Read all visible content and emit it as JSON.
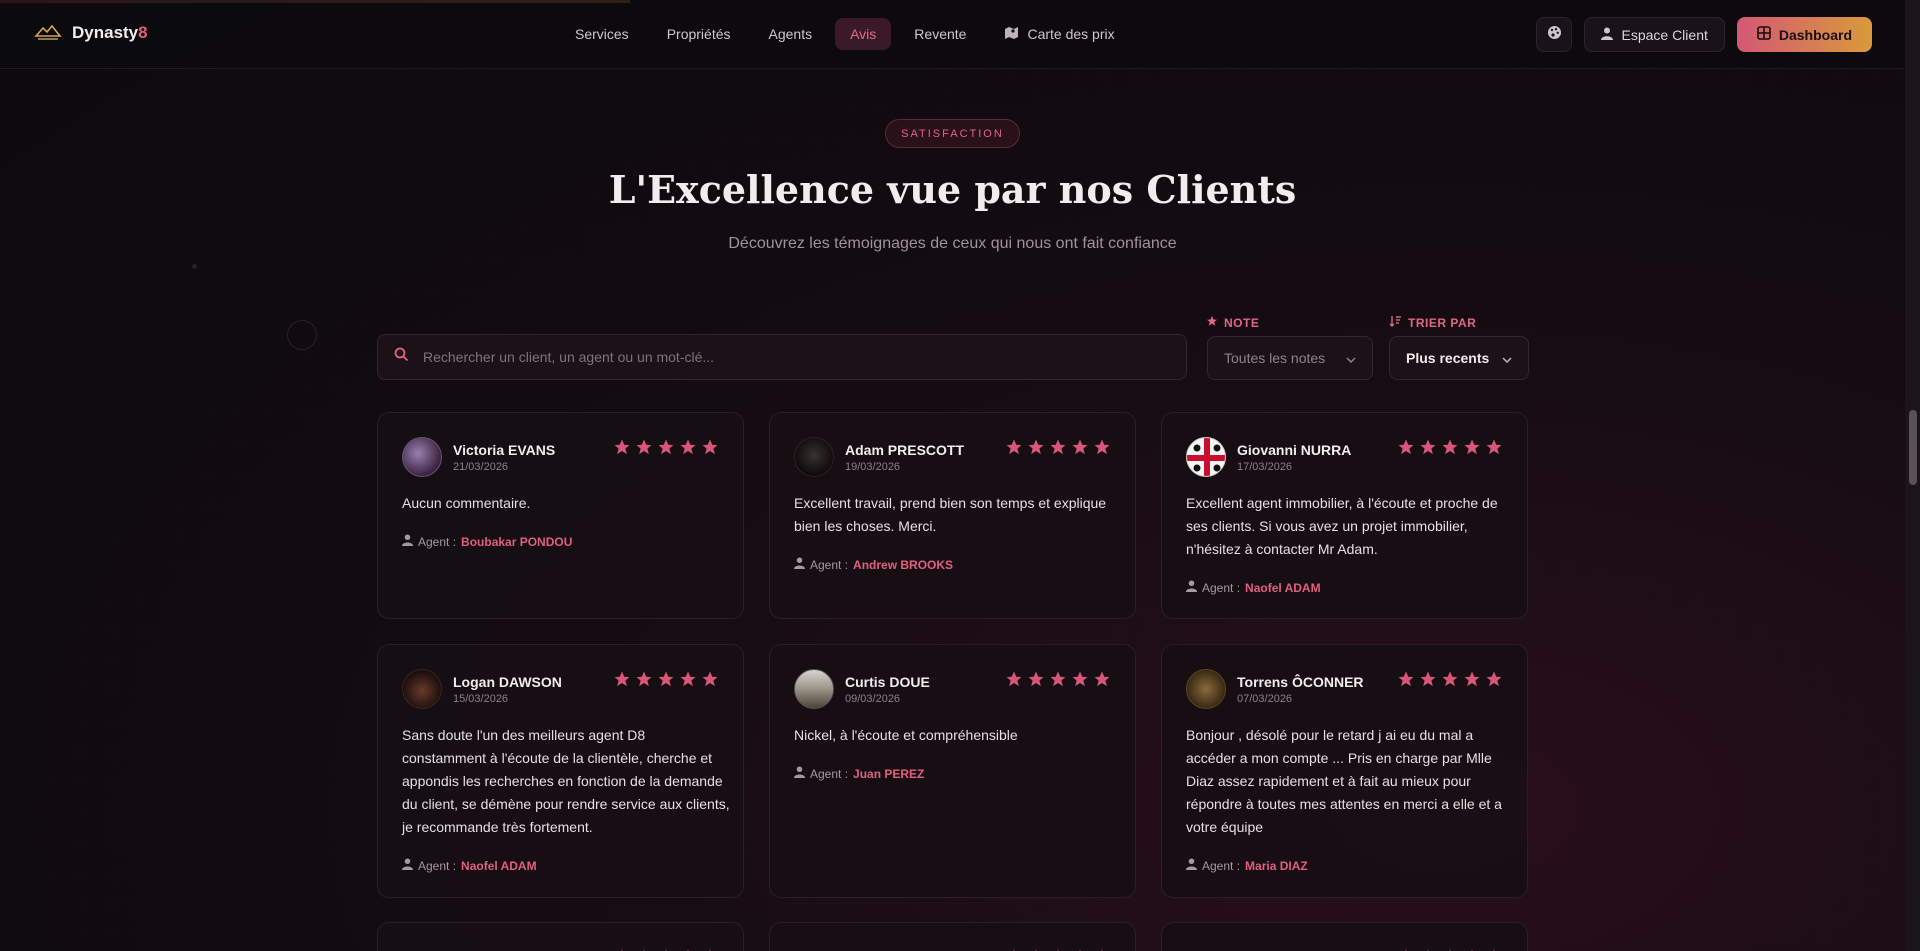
{
  "brand": {
    "name_main": "Dynasty",
    "name_accent": "8"
  },
  "nav": {
    "links": [
      {
        "label": "Services",
        "active": false
      },
      {
        "label": "Propriétés",
        "active": false
      },
      {
        "label": "Agents",
        "active": false
      },
      {
        "label": "Avis",
        "active": true
      },
      {
        "label": "Revente",
        "active": false
      },
      {
        "label": "Carte des prix",
        "active": false,
        "icon": "map-icon"
      }
    ],
    "client_label": "Espace Client",
    "dashboard_label": "Dashboard"
  },
  "hero": {
    "badge": "SATISFACTION",
    "title": "L'Excellence vue par nos Clients",
    "subtitle": "Découvrez les témoignages de ceux qui nous ont fait confiance"
  },
  "filters": {
    "search_placeholder": "Rechercher un client, un agent ou un mot-clé...",
    "note_label": "NOTE",
    "note_value": "Toutes les notes",
    "sort_label": "TRIER PAR",
    "sort_value": "Plus recents"
  },
  "agent_prefix": "Agent :",
  "reviews": [
    {
      "name": "Victoria EVANS",
      "date": "21/03/2026",
      "rating": 5,
      "text": "Aucun commentaire.",
      "agent": "Boubakar PONDOU"
    },
    {
      "name": "Adam PRESCOTT",
      "date": "19/03/2026",
      "rating": 5,
      "text": "Excellent travail, prend bien son temps et explique bien les choses. Merci.",
      "agent": "Andrew BROOKS"
    },
    {
      "name": "Giovanni NURRA",
      "date": "17/03/2026",
      "rating": 5,
      "text": "Excellent agent immobilier, à l'écoute et proche de ses clients. Si vous avez un projet immobilier, n'hésitez à contacter Mr Adam.",
      "agent": "Naofel ADAM"
    },
    {
      "name": "Logan DAWSON",
      "date": "15/03/2026",
      "rating": 5,
      "text": "Sans doute l'un des meilleurs agent D8 constamment à l'écoute de la clientèle, cherche et appondis les recherches en fonction de la demande du client, se démène pour rendre service aux clients, je recommande très fortement.",
      "agent": "Naofel ADAM"
    },
    {
      "name": "Curtis DOUE",
      "date": "09/03/2026",
      "rating": 5,
      "text": "Nickel, à l'écoute et compréhensible",
      "agent": "Juan PEREZ"
    },
    {
      "name": "Torrens ÔCONNER",
      "date": "07/03/2026",
      "rating": 5,
      "text": "Bonjour , désolé pour le retard j ai eu du mal a accéder a mon compte ... Pris en charge par Mlle Diaz assez rapidement et à fait au mieux pour répondre à toutes mes attentes en merci a elle et a votre équipe",
      "agent": "Maria DIAZ"
    }
  ],
  "colors": {
    "accent": "#e05d7f",
    "gold": "#d99a3a",
    "star": "#d9567a"
  }
}
